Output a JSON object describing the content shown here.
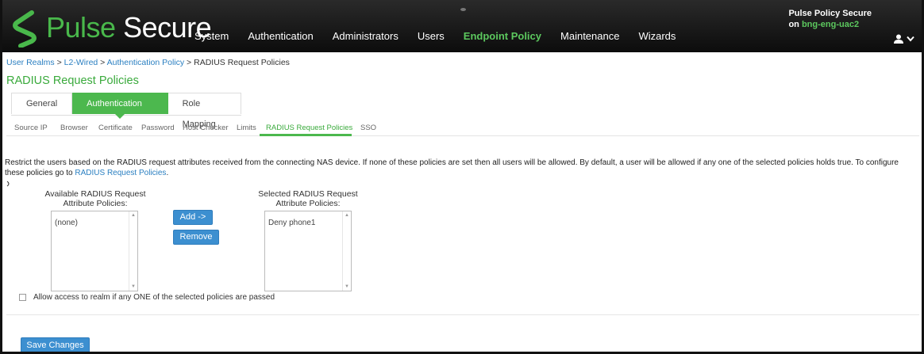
{
  "header": {
    "brand_part1": "Pulse",
    "brand_part2": "Secure",
    "nav": [
      {
        "label": "System",
        "active": false
      },
      {
        "label": "Authentication",
        "active": false
      },
      {
        "label": "Administrators",
        "active": false
      },
      {
        "label": "Users",
        "active": false
      },
      {
        "label": "Endpoint Policy",
        "active": true
      },
      {
        "label": "Maintenance",
        "active": false
      },
      {
        "label": "Wizards",
        "active": false
      }
    ],
    "system_line1": "Pulse Policy Secure",
    "system_on": "on",
    "system_host": "bng-eng-uac2",
    "user_icon": "user-icon",
    "chevron": "chevron-down-icon"
  },
  "breadcrumb": {
    "items": [
      "User Realms",
      "L2-Wired",
      "Authentication Policy"
    ],
    "sep": " > ",
    "current": "RADIUS Request Policies"
  },
  "page_title": "RADIUS Request Policies",
  "main_tabs": [
    {
      "label": "General",
      "active": false
    },
    {
      "label": "Authentication Policy",
      "active": true
    },
    {
      "label": "Role Mapping",
      "active": false
    }
  ],
  "sub_tabs": [
    {
      "label": "Source IP",
      "active": false
    },
    {
      "label": "Browser",
      "active": false
    },
    {
      "label": "Certificate",
      "active": false
    },
    {
      "label": "Password",
      "active": false
    },
    {
      "label": "Host Checker",
      "active": false
    },
    {
      "label": "Limits",
      "active": false
    },
    {
      "label": "RADIUS Request Policies",
      "active": true
    },
    {
      "label": "SSO",
      "active": false
    }
  ],
  "description": {
    "text": "Restrict the users based on the RADIUS request attributes received from the connecting NAS device. If none of these policies are set then all users will be allowed. By default, a user will be allowed if any one of the selected policies holds true. To configure these policies go to ",
    "link": "RADIUS Request Policies",
    "end": "."
  },
  "available": {
    "label_line1": "Available RADIUS Request",
    "label_line2": "Attribute Policies:",
    "items": [
      "(none)"
    ]
  },
  "selected": {
    "label_line1": "Selected RADIUS Request",
    "label_line2": "Attribute Policies:",
    "items": [
      "Deny phone1"
    ]
  },
  "buttons": {
    "add": "Add ->",
    "remove": "Remove",
    "save": "Save Changes"
  },
  "allow_access": {
    "label": "Allow access to realm if any ONE of the selected policies are passed",
    "checked": false
  },
  "colors": {
    "brand_green": "#49b84b",
    "active_tab": "#4cb84e",
    "link_blue": "#2a7fc1",
    "button_blue": "#3c8fd0"
  }
}
